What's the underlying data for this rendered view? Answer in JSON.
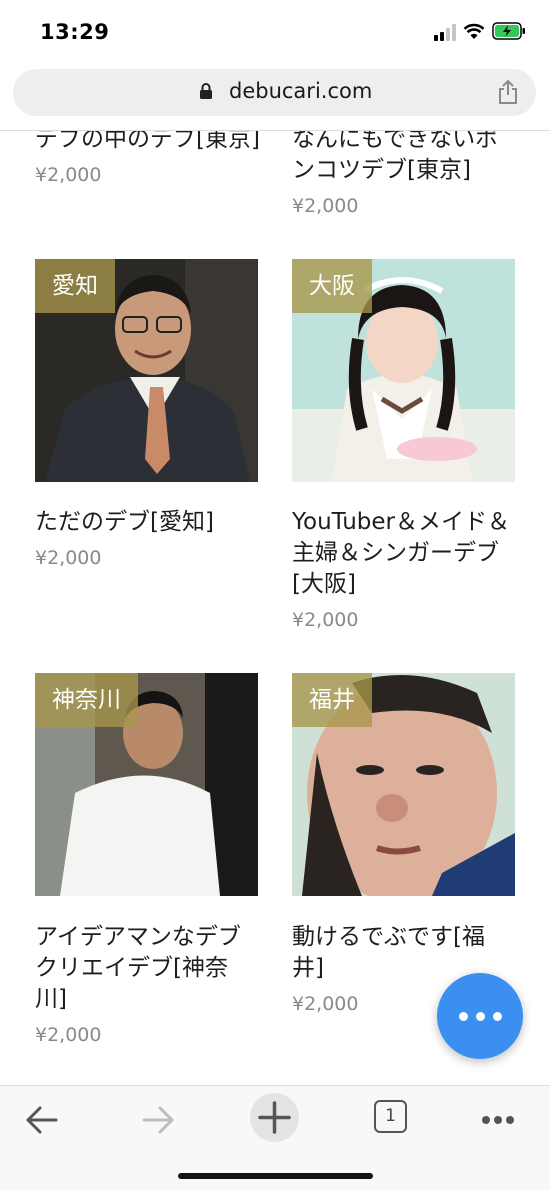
{
  "status_bar": {
    "time": "13:29"
  },
  "browser": {
    "url": "debucari.com",
    "tab_count": "1"
  },
  "products": [
    {
      "title": "デブの中のデブ[東京]",
      "price": "¥2,000"
    },
    {
      "title": "なんにもできないポンコツデブ[東京]",
      "price": "¥2,000"
    },
    {
      "title": "ただのデブ[愛知]",
      "price": "¥2,000",
      "prefecture": "愛知"
    },
    {
      "title": "YouTuber＆メイド＆主婦＆シンガーデブ[大阪]",
      "price": "¥2,000",
      "prefecture": "大阪"
    },
    {
      "title": "アイデアマンなデブ クリエイデブ[神奈川]",
      "price": "¥2,000",
      "prefecture": "神奈川"
    },
    {
      "title": "動けるでぶです[福井]",
      "price": "¥2,000",
      "prefecture": "福井"
    }
  ],
  "colors": {
    "fab": "#3b8ff0",
    "badge": "#a8964a",
    "battery": "#34c759"
  },
  "icons": [
    "lock-icon",
    "share-icon",
    "back-icon",
    "forward-icon",
    "new-tab-icon",
    "tabs-icon",
    "more-icon"
  ]
}
